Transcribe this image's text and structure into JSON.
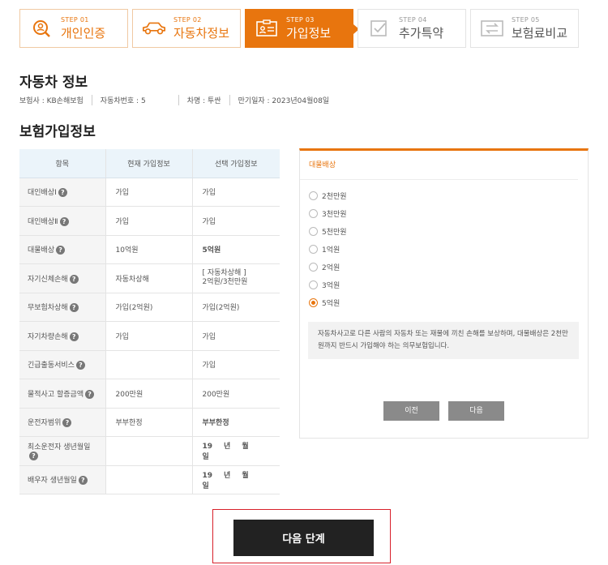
{
  "steps": [
    {
      "label": "STEP 01",
      "name": "개인인증",
      "icon": "search-user-icon"
    },
    {
      "label": "STEP 02",
      "name": "자동차정보",
      "icon": "car-icon"
    },
    {
      "label": "STEP 03",
      "name": "가입정보",
      "icon": "id-card-icon"
    },
    {
      "label": "STEP 04",
      "name": "추가특약",
      "icon": "checkbox-icon"
    },
    {
      "label": "STEP 05",
      "name": "보험료비교",
      "icon": "compare-icon"
    }
  ],
  "car_section": {
    "title": "자동차 정보",
    "insurer": "보험사 : KB손해보험",
    "car_number": "자동차번호 : 5",
    "car_name": "차명 : 투싼",
    "expiry": "만기일자 : 2023년04월08일"
  },
  "insurance_section": {
    "title": "보험가입정보",
    "headers": [
      "항목",
      "현재 가입정보",
      "선택 가입정보"
    ],
    "rows": [
      {
        "item": "대인배상Ⅰ",
        "current": "가입",
        "selected": "가입"
      },
      {
        "item": "대인배상Ⅱ",
        "current": "가입",
        "selected": "가입"
      },
      {
        "item": "대물배상",
        "current": "10억원",
        "selected": "5억원"
      },
      {
        "item": "자기신체손해",
        "current": "자동차상해",
        "selected_line1": "[ 자동차상해 ]",
        "selected_line2": "2억원/3천만원"
      },
      {
        "item": "무보험차상해",
        "current": "가입(2억원)",
        "selected": "가입(2억원)"
      },
      {
        "item": "자기차량손해",
        "current": "가입",
        "selected": "가입"
      },
      {
        "item": "긴급출동서비스",
        "current": "",
        "selected": "가입"
      },
      {
        "item": "물적사고 할증금액",
        "current": "200만원",
        "selected": "200만원"
      },
      {
        "item": "운전자범위",
        "current": "부부한정",
        "selected": "부부한정"
      },
      {
        "item": "최소운전자 생년월일",
        "current": "",
        "date_parts": [
          "19",
          "년",
          "월",
          "일"
        ]
      },
      {
        "item": "배우자 생년월일",
        "current": "",
        "date_parts": [
          "19",
          "년",
          "월",
          "일"
        ]
      }
    ]
  },
  "panel": {
    "title": "대물배상",
    "options": [
      "2천만원",
      "3천만원",
      "5천만원",
      "1억원",
      "2억원",
      "3억원",
      "5억원"
    ],
    "selected_index": 6,
    "description": "자동차사고로 다른 사람의 자동차 또는 재물에 끼친 손해를 보상하며, 대물배상은 2천만원까지 반드시 가입해야 하는 의무보험입니다.",
    "prev_label": "이전",
    "next_label": "다음"
  },
  "next_step_label": "다음 단계",
  "colors": {
    "accent": "#e8750e",
    "header_bg": "#ebf4fa",
    "button_dark": "#222222"
  }
}
